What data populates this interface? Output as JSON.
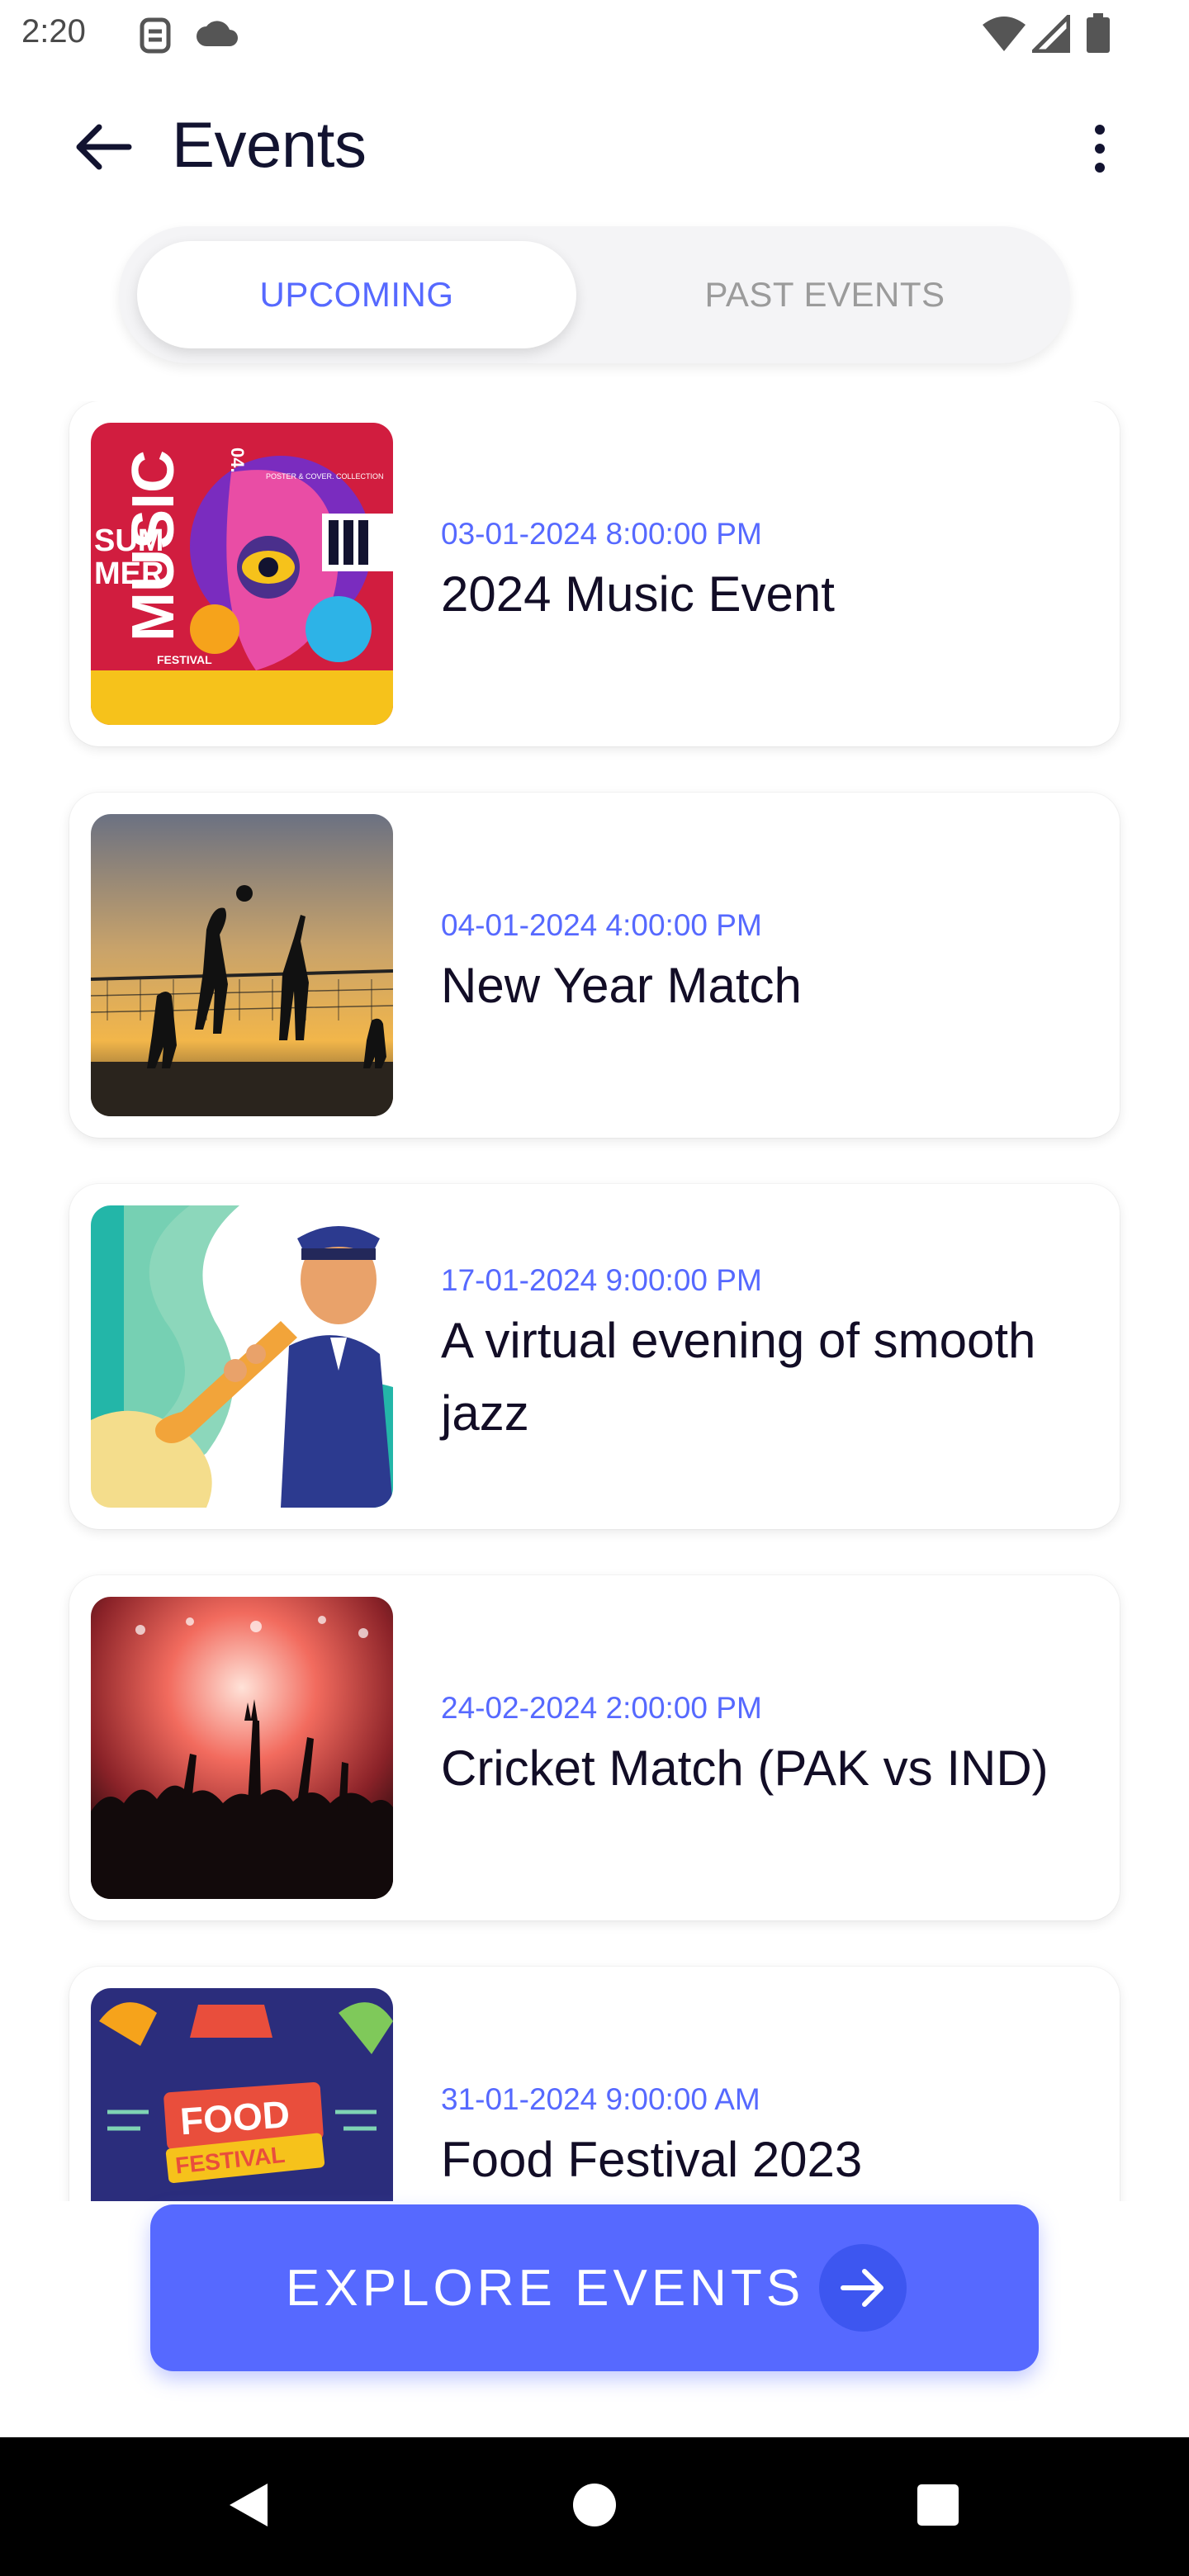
{
  "status_bar": {
    "time": "2:20",
    "icons": [
      "sim-icon",
      "cloud-icon",
      "wifi-icon",
      "signal-icon",
      "battery-icon"
    ]
  },
  "header": {
    "title": "Events",
    "back_icon": "arrow-left-icon",
    "menu_icon": "more-vertical-icon"
  },
  "tabs": [
    {
      "label": "UPCOMING",
      "selected": true
    },
    {
      "label": "PAST EVENTS",
      "selected": false
    }
  ],
  "events": [
    {
      "date": "03-01-2024 8:00:00 PM",
      "title": "2024 Music Event",
      "thumb_text": [
        "SUM",
        "MER",
        "MUSIC",
        "FESTIVAL",
        "04.",
        "POSTER & COVER. COLLECTION"
      ]
    },
    {
      "date": "04-01-2024 4:00:00 PM",
      "title": "New Year Match"
    },
    {
      "date": "17-01-2024 9:00:00 PM",
      "title": "A virtual evening of smooth jazz"
    },
    {
      "date": "24-02-2024 2:00:00 PM",
      "title": "Cricket Match (PAK vs IND)"
    },
    {
      "date": "31-01-2024 9:00:00 AM",
      "title": "Food Festival 2023",
      "thumb_text": [
        "FOOD",
        "FESTIVAL"
      ]
    }
  ],
  "explore_button": {
    "label": "EXPLORE EVENTS",
    "icon": "arrow-right-icon"
  },
  "colors": {
    "accent": "#5669ff",
    "title_text": "#120d26",
    "nav_bar": "#000000"
  },
  "nav": [
    "back-triangle-icon",
    "home-circle-icon",
    "recents-square-icon"
  ]
}
